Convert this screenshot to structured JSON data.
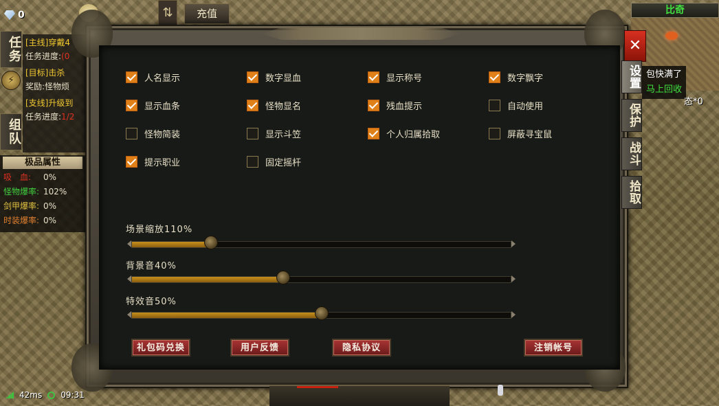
{
  "hud": {
    "gem_icon": "diamond-icon",
    "gem_count": "0",
    "swap_icon": "⇅",
    "recharge_label": "充值"
  },
  "left_tabs": {
    "task": "任务",
    "team": "组队",
    "mid_icon": "⚡"
  },
  "quests": [
    {
      "tag": "[主线]",
      "name": "穿戴4",
      "progress_label": "任务进度:",
      "progress_value": "(0"
    },
    {
      "tag": "[目标]",
      "name": "击杀",
      "sub": "奖励:怪物烦"
    },
    {
      "tag": "[支线]",
      "name": "升级到",
      "progress_label": "任务进度:",
      "progress_value": "1/2"
    }
  ],
  "attributes": {
    "title": "极品属性",
    "rows": [
      {
        "label": "吸　血:",
        "value": "0%"
      },
      {
        "label": "怪物爆率:",
        "value": "102%"
      },
      {
        "label": "剑甲爆率:",
        "value": "0%"
      },
      {
        "label": "时装爆率:",
        "value": "0%"
      }
    ]
  },
  "status": {
    "ping": "42ms",
    "time": "09:31"
  },
  "minimap": {
    "title": "比奇",
    "bag_full": "包快满了",
    "recycle": "马上回收",
    "state": "态*0"
  },
  "dialog": {
    "close_label": "✕",
    "side_tabs": [
      {
        "label": "设置",
        "active": true
      },
      {
        "label": "保护",
        "active": false
      },
      {
        "label": "战斗",
        "active": false
      },
      {
        "label": "拾取",
        "active": false
      }
    ],
    "options": [
      {
        "label": "人名显示",
        "checked": true
      },
      {
        "label": "数字显血",
        "checked": true
      },
      {
        "label": "显示称号",
        "checked": true
      },
      {
        "label": "数字飘字",
        "checked": true
      },
      {
        "label": "显示血条",
        "checked": true
      },
      {
        "label": "怪物显名",
        "checked": true
      },
      {
        "label": "残血提示",
        "checked": true
      },
      {
        "label": "自动使用",
        "checked": false
      },
      {
        "label": "怪物简装",
        "checked": false
      },
      {
        "label": "显示斗笠",
        "checked": false
      },
      {
        "label": "个人归属拾取",
        "checked": true
      },
      {
        "label": "屏蔽寻宝鼠",
        "checked": false
      },
      {
        "label": "提示职业",
        "checked": true
      },
      {
        "label": "固定摇杆",
        "checked": false
      }
    ],
    "sliders": [
      {
        "label": "场景缩放110%",
        "value": 0.21
      },
      {
        "label": "背景音40%",
        "value": 0.4
      },
      {
        "label": "特效音50%",
        "value": 0.5
      }
    ],
    "buttons": {
      "gift_code": "礼包码兑换",
      "feedback": "用户反馈",
      "privacy": "隐私协议",
      "cancel_account": "注销帐号"
    }
  }
}
